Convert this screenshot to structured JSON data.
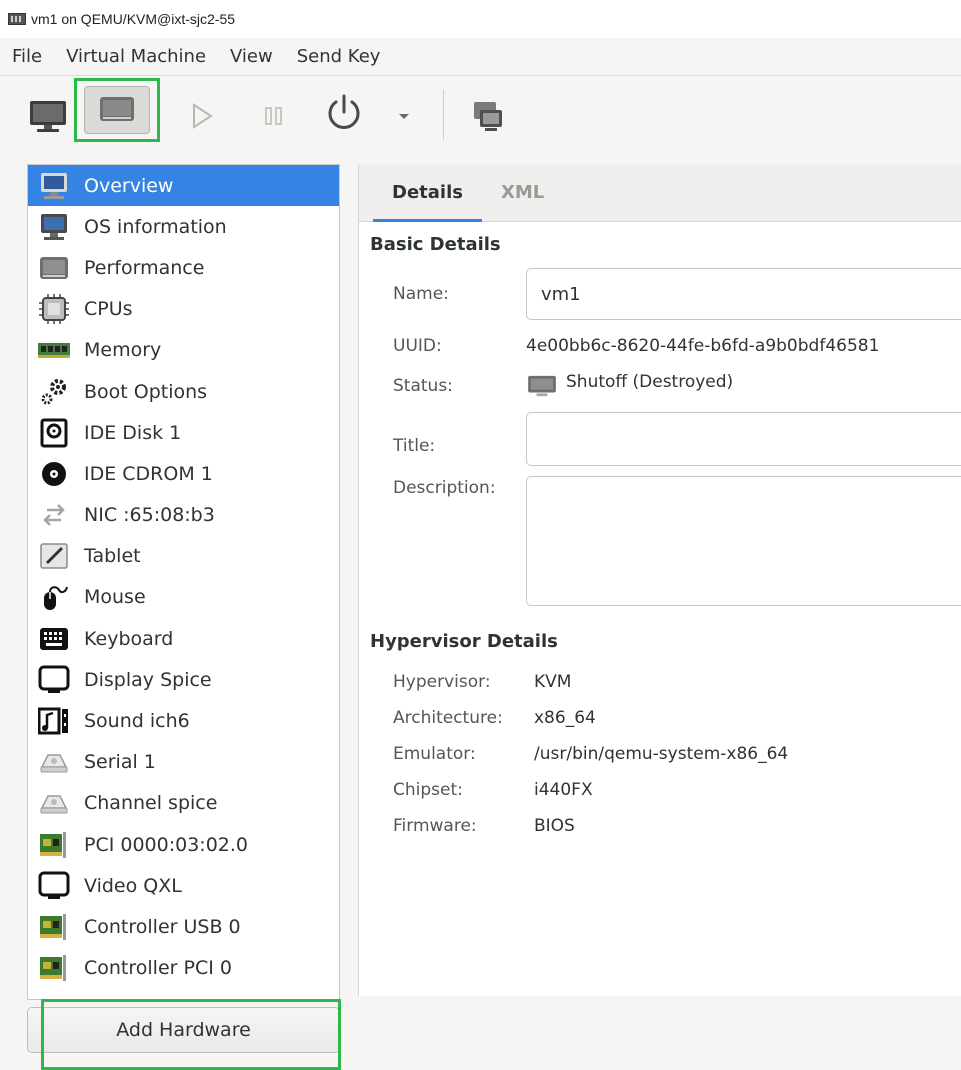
{
  "window": {
    "title": "vm1 on QEMU/KVM@ixt-sjc2-55"
  },
  "menubar": {
    "items": [
      "File",
      "Virtual Machine",
      "View",
      "Send Key"
    ]
  },
  "toolbar": {
    "buttons": [
      "monitor-icon",
      "details-icon",
      "run-icon",
      "pause-icon",
      "power-icon",
      "dropdown-arrow-icon",
      "console-icon"
    ],
    "highlight_color": "#2db84b"
  },
  "hardware": {
    "items": [
      {
        "label": "Overview",
        "icon": "overview-icon",
        "selected": true
      },
      {
        "label": "OS information",
        "icon": "os-info-icon"
      },
      {
        "label": "Performance",
        "icon": "performance-icon"
      },
      {
        "label": "CPUs",
        "icon": "cpu-icon"
      },
      {
        "label": "Memory",
        "icon": "memory-icon"
      },
      {
        "label": "Boot Options",
        "icon": "boot-options-icon"
      },
      {
        "label": "IDE Disk 1",
        "icon": "disk-icon"
      },
      {
        "label": "IDE CDROM 1",
        "icon": "cdrom-icon"
      },
      {
        "label": "NIC :65:08:b3",
        "icon": "network-icon"
      },
      {
        "label": "Tablet",
        "icon": "tablet-icon"
      },
      {
        "label": "Mouse",
        "icon": "mouse-icon"
      },
      {
        "label": "Keyboard",
        "icon": "keyboard-icon"
      },
      {
        "label": "Display Spice",
        "icon": "display-icon"
      },
      {
        "label": "Sound ich6",
        "icon": "sound-icon"
      },
      {
        "label": "Serial 1",
        "icon": "serial-icon"
      },
      {
        "label": "Channel spice",
        "icon": "channel-icon"
      },
      {
        "label": "PCI 0000:03:02.0",
        "icon": "pci-card-icon"
      },
      {
        "label": "Video QXL",
        "icon": "video-icon"
      },
      {
        "label": "Controller USB 0",
        "icon": "controller-usb-icon"
      },
      {
        "label": "Controller PCI 0",
        "icon": "controller-pci-icon"
      }
    ],
    "add_button": "Add Hardware",
    "selected_color": "#3584e4"
  },
  "details": {
    "tabs": [
      {
        "label": "Details",
        "active": true
      },
      {
        "label": "XML",
        "active": false
      }
    ],
    "basic": {
      "title": "Basic Details",
      "name_label": "Name:",
      "name_value": "vm1",
      "uuid_label": "UUID:",
      "uuid_value": "4e00bb6c-8620-44fe-b6fd-a9b0bdf46581",
      "status_label": "Status:",
      "status_value": "Shutoff (Destroyed)",
      "title_label": "Title:",
      "title_value": "",
      "description_label": "Description:",
      "description_value": ""
    },
    "hypervisor": {
      "title": "Hypervisor Details",
      "rows": [
        {
          "label": "Hypervisor:",
          "value": "KVM"
        },
        {
          "label": "Architecture:",
          "value": "x86_64"
        },
        {
          "label": "Emulator:",
          "value": "/usr/bin/qemu-system-x86_64"
        },
        {
          "label": "Chipset:",
          "value": "i440FX"
        },
        {
          "label": "Firmware:",
          "value": "BIOS"
        }
      ]
    }
  }
}
